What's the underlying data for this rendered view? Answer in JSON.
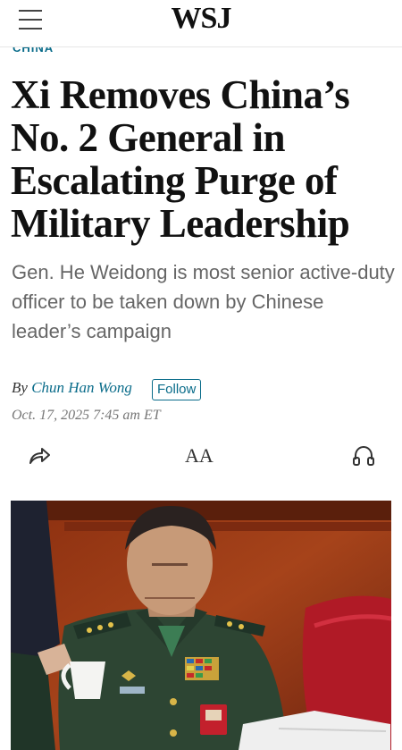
{
  "header": {
    "logo": "WSJ",
    "menu_icon": "hamburger-menu-icon"
  },
  "article": {
    "section": "CHINA",
    "headline": "Xi Removes China’s No. 2 General in Escalating Purge of Military Leadership",
    "dek": "Gen. He Weidong is most senior active-duty officer to be taken down by Chinese leader’s campaign",
    "byline_prefix": "By",
    "author": "Chun Han Wong",
    "follow_label": "Follow",
    "date": "Oct. 17, 2025 7:45 am ET"
  },
  "toolbar": {
    "share_icon": "share-arrow-icon",
    "text_size_label": "AA",
    "text_size_icon": "text-size-icon",
    "audio_icon": "headphones-icon"
  },
  "colors": {
    "accent": "#0a6c8a",
    "headline": "#111111",
    "dek": "#666666"
  }
}
